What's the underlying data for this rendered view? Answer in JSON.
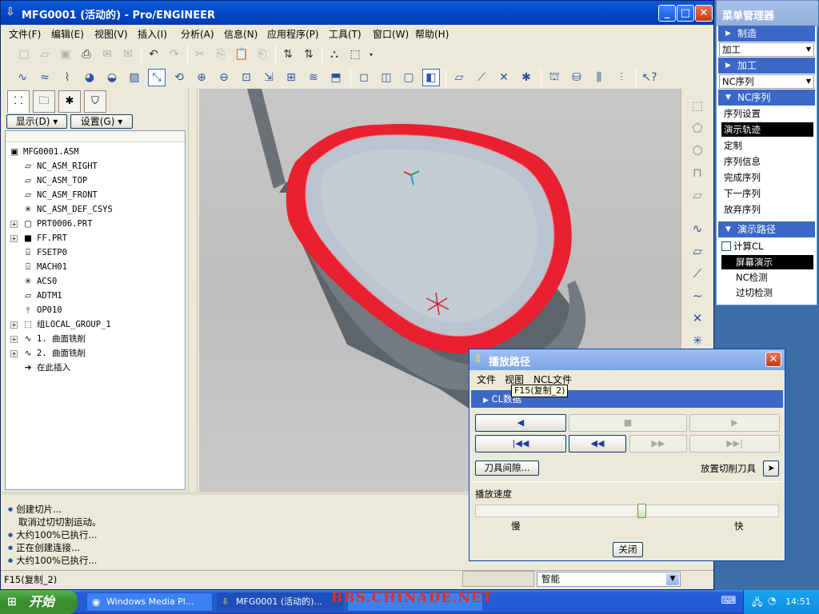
{
  "window": {
    "title": "MFG0001 (活动的) - Pro/ENGINEER",
    "controls": [
      "minimize",
      "maximize",
      "close"
    ]
  },
  "menubar": [
    "文件(F)",
    "编辑(E)",
    "视图(V)",
    "插入(I)",
    "分析(A)",
    "信息(N)",
    "应用程序(P)",
    "工具(T)",
    "窗口(W)",
    "帮助(H)"
  ],
  "toolbar1": [
    {
      "icon": "new-icon",
      "glyph": "□",
      "enabled": false
    },
    {
      "icon": "open-icon",
      "glyph": "▱",
      "enabled": false
    },
    {
      "icon": "save-icon",
      "glyph": "▣",
      "enabled": false
    },
    {
      "icon": "print-icon",
      "glyph": "⎙",
      "enabled": true
    },
    {
      "icon": "email-icon",
      "glyph": "✉",
      "enabled": false
    },
    {
      "icon": "email-link-icon",
      "glyph": "✉",
      "enabled": false
    },
    {
      "icon": "undo-icon",
      "glyph": "↶",
      "enabled": true
    },
    {
      "icon": "redo-icon",
      "glyph": "↷",
      "enabled": false
    },
    {
      "icon": "cut-icon",
      "glyph": "✂",
      "enabled": false
    },
    {
      "icon": "copy-icon",
      "glyph": "⎘",
      "enabled": false
    },
    {
      "icon": "paste-icon",
      "glyph": "📋",
      "enabled": true
    },
    {
      "icon": "paste-special-icon",
      "glyph": "⎗",
      "enabled": false
    },
    {
      "icon": "regenerate-icon",
      "glyph": "⇅",
      "enabled": true
    },
    {
      "icon": "regen-manager-icon",
      "glyph": "⇅",
      "enabled": true
    },
    {
      "icon": "find-icon",
      "glyph": "⛬",
      "enabled": true
    },
    {
      "icon": "select-box-icon",
      "glyph": "⬚",
      "enabled": true
    }
  ],
  "toolbar2": [
    {
      "icon": "csys-icon",
      "glyph": "∿"
    },
    {
      "icon": "curve-icon",
      "glyph": "≈"
    },
    {
      "icon": "spin-center-icon",
      "glyph": "⌇"
    },
    {
      "icon": "appearance-icon",
      "glyph": "◕"
    },
    {
      "icon": "render-icon",
      "glyph": "◒"
    },
    {
      "icon": "view-manager-icon",
      "glyph": "▨"
    },
    {
      "icon": "orient-icon",
      "glyph": "⤡"
    },
    {
      "icon": "spin-icon",
      "glyph": "⟲"
    },
    {
      "icon": "zoom-in-icon",
      "glyph": "⊕"
    },
    {
      "icon": "zoom-out-icon",
      "glyph": "⊖"
    },
    {
      "icon": "refit-icon",
      "glyph": "⊡"
    },
    {
      "icon": "reorient-icon",
      "glyph": "⇲"
    },
    {
      "icon": "saved-views-icon",
      "glyph": "⊞"
    },
    {
      "icon": "layers-icon",
      "glyph": "≋"
    },
    {
      "icon": "repaint-icon",
      "glyph": "⬒"
    },
    {
      "icon": "wireframe-icon",
      "glyph": "◻"
    },
    {
      "icon": "hidden-line-icon",
      "glyph": "◫"
    },
    {
      "icon": "no-hidden-icon",
      "glyph": "▢"
    },
    {
      "icon": "shading-icon",
      "glyph": "◧"
    },
    {
      "icon": "datum-plane-display-icon",
      "glyph": "⏥"
    },
    {
      "icon": "datum-axis-display-icon",
      "glyph": "⟋"
    },
    {
      "icon": "point-display-icon",
      "glyph": "✕"
    },
    {
      "icon": "csys-display-icon",
      "glyph": "✱"
    },
    {
      "icon": "mfg-setup-icon",
      "glyph": "⛫"
    },
    {
      "icon": "workpiece-icon",
      "glyph": "⛁"
    },
    {
      "icon": "tool-icon",
      "glyph": "⫼"
    },
    {
      "icon": "cl-data-icon",
      "glyph": "⫶"
    },
    {
      "icon": "context-help-icon",
      "glyph": "↖?"
    }
  ],
  "left_tabs": [
    "model-tree-tab",
    "folder-tab",
    "favorites-tab",
    "layer-tab"
  ],
  "left_controls": {
    "display": "显示(D)",
    "settings": "设置(G)"
  },
  "tree": [
    {
      "icon": "assembly-icon",
      "glyph": "▣",
      "label": "MFG0001.ASM",
      "expand": null,
      "indent": 0
    },
    {
      "icon": "datum-plane-icon",
      "glyph": "▱",
      "label": "NC_ASM_RIGHT",
      "expand": null,
      "indent": 1
    },
    {
      "icon": "datum-plane-icon",
      "glyph": "▱",
      "label": "NC_ASM_TOP",
      "expand": null,
      "indent": 1
    },
    {
      "icon": "datum-plane-icon",
      "glyph": "▱",
      "label": "NC_ASM_FRONT",
      "expand": null,
      "indent": 1
    },
    {
      "icon": "csys-icon",
      "glyph": "✳",
      "label": "NC_ASM_DEF_CSYS",
      "expand": null,
      "indent": 1
    },
    {
      "icon": "part-icon",
      "glyph": "▢",
      "label": "PRT0006.PRT",
      "expand": "+",
      "indent": 1
    },
    {
      "icon": "part-black-icon",
      "glyph": "■",
      "label": "FF.PRT",
      "expand": "+",
      "indent": 1
    },
    {
      "icon": "workcell-icon",
      "glyph": "⌸",
      "label": "FSETP0",
      "expand": null,
      "indent": 1
    },
    {
      "icon": "machine-icon",
      "glyph": "⌹",
      "label": "MACH01",
      "expand": null,
      "indent": 1
    },
    {
      "icon": "csys-icon",
      "glyph": "✳",
      "label": "ACS0",
      "expand": null,
      "indent": 1
    },
    {
      "icon": "datum-plane-icon",
      "glyph": "▱",
      "label": "ADTM1",
      "expand": null,
      "indent": 1
    },
    {
      "icon": "operation-icon",
      "glyph": "⫯",
      "label": "OP010",
      "expand": null,
      "indent": 1
    },
    {
      "icon": "group-icon",
      "glyph": "⬚",
      "label": "组LOCAL_GROUP_1",
      "expand": "+",
      "indent": 1
    },
    {
      "icon": "surface-mill-icon",
      "glyph": "∿",
      "label": "1. 曲面铣削",
      "expand": "+",
      "indent": 1
    },
    {
      "icon": "surface-mill-icon",
      "glyph": "∿",
      "label": "2. 曲面铣削",
      "expand": "+",
      "indent": 1
    },
    {
      "icon": "insert-here-icon",
      "glyph": "➜",
      "label": "在此插入",
      "expand": null,
      "indent": 1
    }
  ],
  "right_toolbar": [
    {
      "icon": "feature-icon-1",
      "glyph": "⬚"
    },
    {
      "icon": "feature-icon-2",
      "glyph": "⬠"
    },
    {
      "icon": "feature-icon-3",
      "glyph": "⬡"
    },
    {
      "icon": "feature-icon-4",
      "glyph": "⊓"
    },
    {
      "icon": "feature-icon-5",
      "glyph": "⏥"
    },
    {
      "icon": "sketch-curve-icon",
      "glyph": "∿"
    },
    {
      "icon": "datum-plane-icon",
      "glyph": "▱"
    },
    {
      "icon": "datum-axis-icon",
      "glyph": "⟋"
    },
    {
      "icon": "datum-curve-icon",
      "glyph": "∼"
    },
    {
      "icon": "datum-point-icon",
      "glyph": "✕"
    },
    {
      "icon": "datum-csys-icon",
      "glyph": "✳"
    }
  ],
  "messages": [
    "创建切片...",
    "取消过切切割运动。",
    "大约100%已执行...",
    "正在创建连接...",
    "大约100%已执行..."
  ],
  "status_left": "F15(复制_2)",
  "status_right": "智能",
  "menu_manager": {
    "title": "菜单管理器",
    "manufacture": "制造",
    "machining_select": "加工",
    "machining": "加工",
    "nc_seq_select": "NC序列",
    "nc_seq": "NC序列",
    "nc_items": [
      "序列设置",
      "演示轨迹",
      "定制",
      "序列信息",
      "完成序列",
      "下一序列",
      "放弃序列"
    ],
    "nc_selected_index": 1,
    "demo_path": "演示路径",
    "compute_cl": "计算CL",
    "demo_items": [
      "屏幕演示",
      "NC检测",
      "过切检测"
    ],
    "demo_selected_index": 0
  },
  "play_dialog": {
    "title": "播放路径",
    "menu": [
      "文件",
      "视图",
      "NCL文件"
    ],
    "tooltip": "F15(复制_2)",
    "cl_data": "CL数据",
    "tool_clearance": "刀具间隙...",
    "place_tool": "放置切削刀具",
    "speed_label": "播放速度",
    "speed_value": 0.55,
    "slow": "慢",
    "fast": "快",
    "close": "关闭"
  },
  "taskbar": {
    "start": "开始",
    "tasks": [
      "Windows Media Pl...",
      "MFG0001 (活动的)..."
    ],
    "watermark": "BBS.CHINADE.NET",
    "time": "14:51"
  }
}
